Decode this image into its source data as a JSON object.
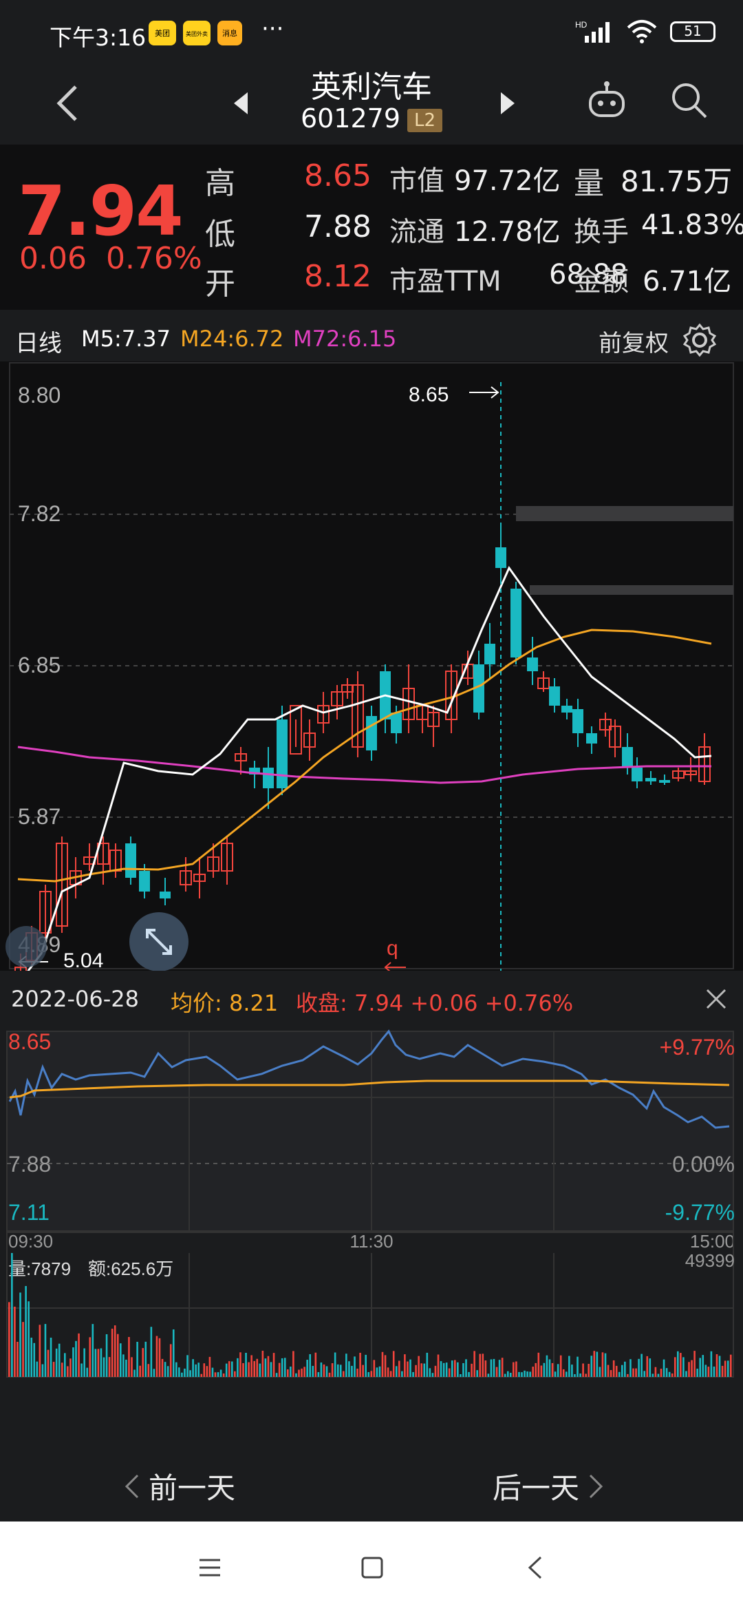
{
  "status": {
    "time": "下午3:16",
    "badges": [
      "美团",
      "美团外卖",
      "消息"
    ],
    "dots": "···",
    "network": "HD",
    "battery": "51"
  },
  "header": {
    "name": "英利汽车",
    "code": "601279",
    "badge": "L2"
  },
  "quote": {
    "price": "7.94",
    "change": "0.06",
    "change_pct": "0.76%",
    "rows": [
      {
        "l1": "高",
        "v1": "8.65",
        "v1_color": "#f2453d",
        "l2": "市值",
        "v2": "97.72亿",
        "l3": "量",
        "v3": "81.75万"
      },
      {
        "l1": "低",
        "v1": "7.88",
        "v1_color": "#f1f1f1",
        "l2": "流通",
        "v2": "12.78亿",
        "l3": "换手",
        "v3": "41.83%"
      },
      {
        "l1": "开",
        "v1": "8.12",
        "v1_color": "#f2453d",
        "l2": "市盈TTM",
        "v2": "68.88",
        "l3": "金额",
        "v3": "6.71亿"
      }
    ]
  },
  "kline": {
    "period": "日线",
    "m5": "M5:7.37",
    "m24": "M24:6.72",
    "m72": "M72:6.15",
    "adjust": "前复权",
    "y_labels": [
      "8.80",
      "7.82",
      "6.85",
      "5.87",
      "4.89"
    ],
    "high_marker": "8.65",
    "low_marker": "5.04",
    "colors": {
      "up": "#f2453d",
      "down": "#1ab9c2",
      "m5": "#ffffff",
      "m24": "#f5a623",
      "m72": "#e040c0"
    }
  },
  "intraday": {
    "date": "2022-06-28",
    "avg_label": "均价:",
    "avg_value": "8.21",
    "close_label": "收盘:",
    "close_value": "7.94",
    "close_change": "+0.06",
    "close_pct": "+0.76%",
    "y_top": "8.65",
    "y_mid": "7.88",
    "y_bot": "7.11",
    "pct_top": "+9.77%",
    "pct_mid": "0.00%",
    "pct_bot": "-9.77%",
    "t_start": "09:30",
    "t_mid": "11:30",
    "t_end": "15:00",
    "vol_label": "量:7879",
    "amt_label": "额:625.6万",
    "vol_max": "49399"
  },
  "nav": {
    "prev_day": "前一天",
    "next_day": "后一天"
  }
}
